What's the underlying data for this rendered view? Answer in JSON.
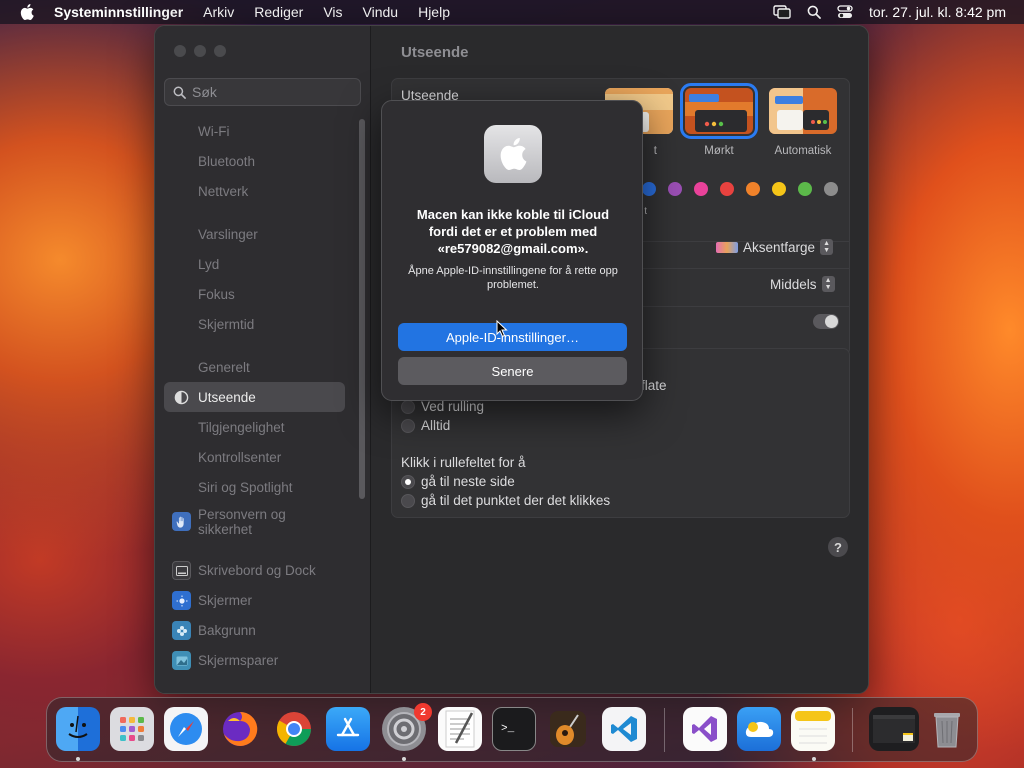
{
  "menubar": {
    "app_name": "Systeminnstillinger",
    "menus": [
      "Arkiv",
      "Rediger",
      "Vis",
      "Vindu",
      "Hjelp"
    ],
    "clock": "tor. 27. jul. kl. 8:42 pm"
  },
  "sidebar": {
    "search_placeholder": "Søk",
    "items": [
      {
        "label": "Wi-Fi"
      },
      {
        "label": "Bluetooth"
      },
      {
        "label": "Nettverk"
      },
      {
        "label": "Varslinger"
      },
      {
        "label": "Lyd"
      },
      {
        "label": "Fokus"
      },
      {
        "label": "Skjermtid"
      },
      {
        "label": "Generelt"
      },
      {
        "label": "Utseende"
      },
      {
        "label": "Tilgjengelighet"
      },
      {
        "label": "Kontrollsenter"
      },
      {
        "label": "Siri og Spotlight"
      },
      {
        "label": "Personvern og sikkerhet"
      },
      {
        "label": "Skrivebord og Dock"
      },
      {
        "label": "Skjermer"
      },
      {
        "label": "Bakgrunn"
      },
      {
        "label": "Skjermsparer"
      }
    ]
  },
  "content": {
    "title": "Utseende",
    "appearance_label": "Utseende",
    "options": [
      {
        "label": "Lyst",
        "visible": "t"
      },
      {
        "label": "Mørkt"
      },
      {
        "label": "Automatisk"
      }
    ],
    "accent_colors": [
      "#2a6fe0",
      "#9b4fb5",
      "#e9429a",
      "#e8423f",
      "#f0822a",
      "#f5c518",
      "#5cb94a",
      "#8c8c8c"
    ],
    "accent_partial_text": "t",
    "highlight_value": "Aksentfarge",
    "sidebar_icon_size_value": "Middels",
    "scroll_partial_text": "flate",
    "scroll_when_scrolling": "Ved rulling",
    "scroll_always": "Alltid",
    "click_scroll_label": "Klikk i rullefeltet for å",
    "click_next_page": "gå til neste side",
    "click_spot": "gå til det punktet der det klikkes",
    "help": "?"
  },
  "alert": {
    "title": "Macen kan ikke koble til iCloud fordi det er et problem med «re579082@gmail.com».",
    "message": "Åpne Apple-ID-innstillingene for å rette opp problemet.",
    "primary_button": "Apple-ID-innstillinger…",
    "secondary_button": "Senere"
  },
  "dock": {
    "apps": [
      "Finder",
      "Launchpad",
      "Safari",
      "Firefox",
      "Chrome",
      "App Store",
      "Systeminnstillinger",
      "TextEdit",
      "Terminal",
      "GarageBand",
      "Visual Studio Code",
      "Visual Studio",
      "iCloud",
      "Notater",
      "Skjermbilde",
      "Papirkurv"
    ],
    "settings_badge": "2"
  }
}
